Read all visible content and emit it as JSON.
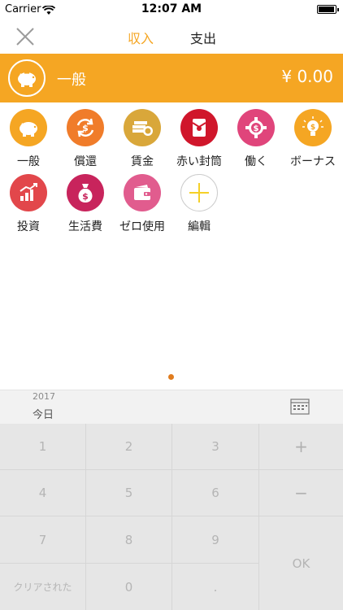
{
  "status_bar": {
    "carrier": "Carrier",
    "time": "12:07 AM"
  },
  "nav": {
    "tab_income": "収入",
    "tab_expense": "支出",
    "active_color": "#f5a623"
  },
  "selected": {
    "name": "一般",
    "amount": "¥ 0.00",
    "bar_color": "#f5a623"
  },
  "categories": [
    {
      "label": "一般",
      "icon": "piggy-bank-icon",
      "color": "#f5a623"
    },
    {
      "label": "償還",
      "icon": "refund-cycle-icon",
      "color": "#f07c2a"
    },
    {
      "label": "賃金",
      "icon": "money-stack-icon",
      "color": "#d9a73a"
    },
    {
      "label": "赤い封筒",
      "icon": "red-envelope-icon",
      "color": "#d0162b"
    },
    {
      "label": "働く",
      "icon": "gear-coin-icon",
      "color": "#e0457b"
    },
    {
      "label": "ボーナス",
      "icon": "lightbulb-coin-icon",
      "color": "#f5a623"
    },
    {
      "label": "投資",
      "icon": "growth-chart-icon",
      "color": "#e2474b"
    },
    {
      "label": "生活費",
      "icon": "money-bag-icon",
      "color": "#c8245c"
    },
    {
      "label": "ゼロ使用",
      "icon": "wallet-icon",
      "color": "#e15c8e"
    },
    {
      "label": "編輯",
      "icon": "add-icon",
      "color": "#f5d028"
    }
  ],
  "date": {
    "year": "2017",
    "today": "今日"
  },
  "keypad": {
    "k1": "1",
    "k2": "2",
    "k3": "3",
    "plus": "+",
    "k4": "4",
    "k5": "5",
    "k6": "6",
    "minus": "−",
    "k7": "7",
    "k8": "8",
    "k9": "9",
    "ok": "OK",
    "clear": "クリアされた",
    "k0": "0",
    "dot": "."
  }
}
